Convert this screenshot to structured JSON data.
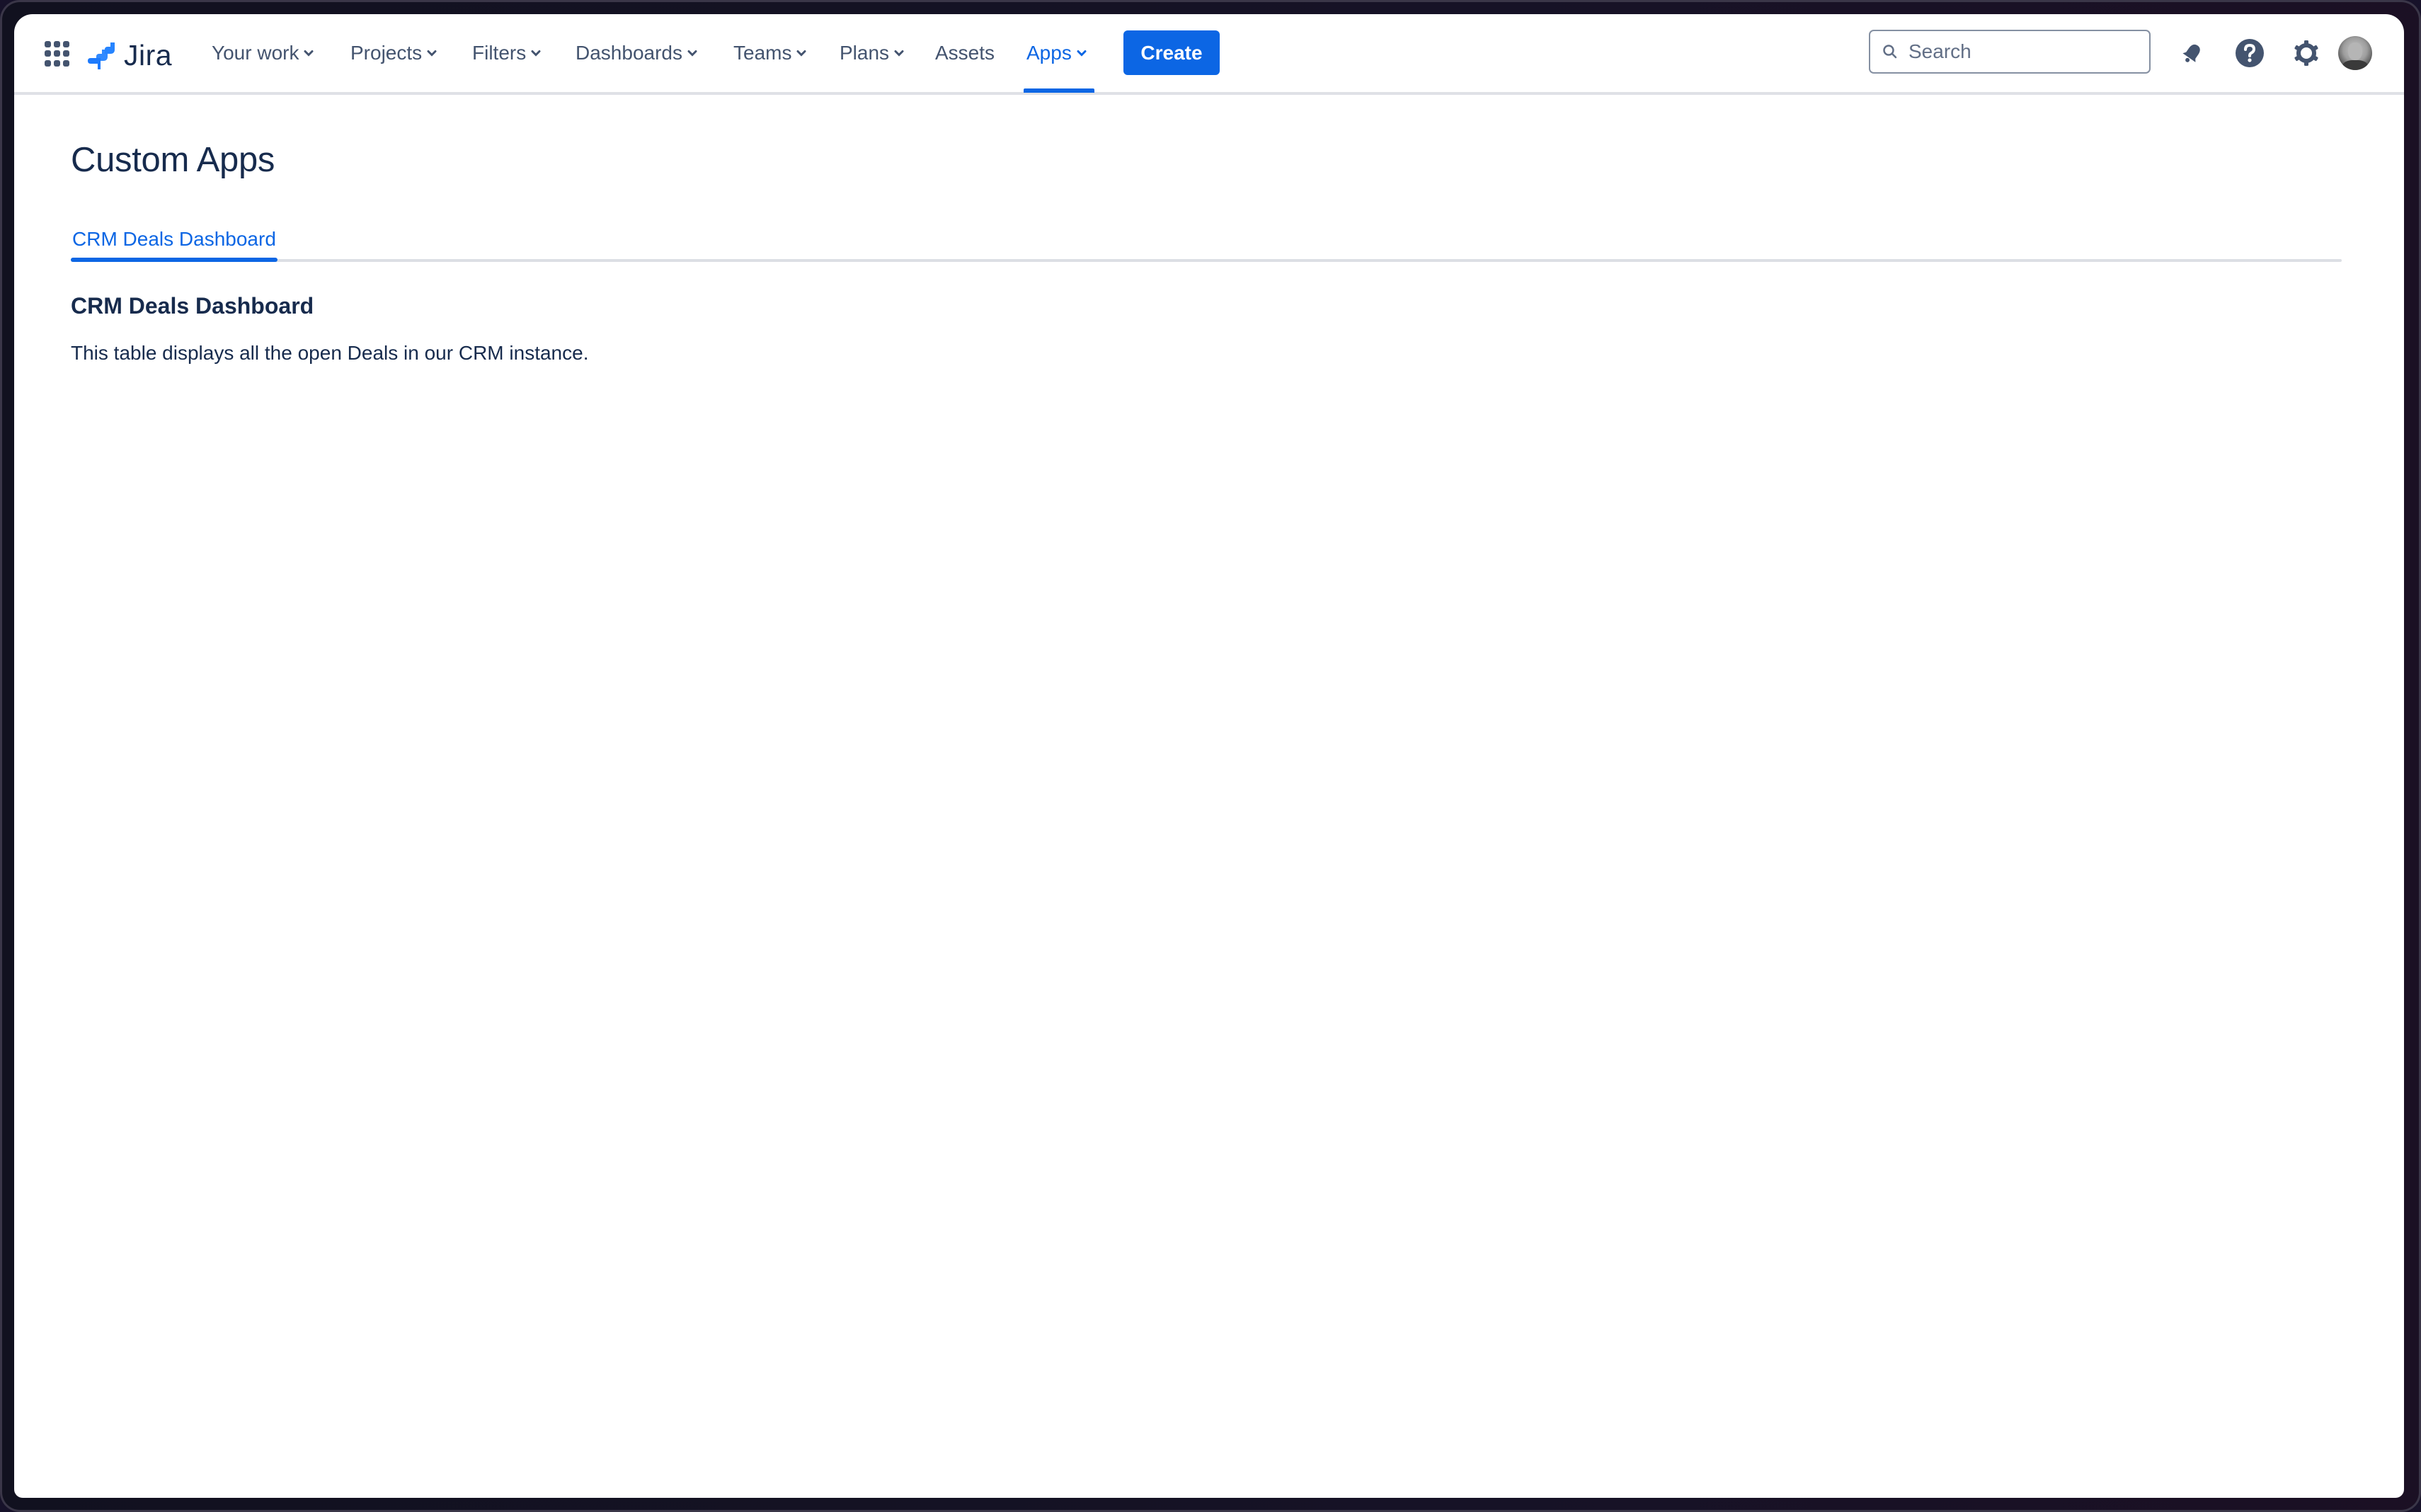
{
  "header": {
    "app_switcher_icon": "grid-dots-icon",
    "logo": {
      "icon": "jira-logo-icon",
      "wordmark": "Jira",
      "brand_color": "#2684ff"
    },
    "nav": [
      {
        "label": "Your work",
        "has_dropdown": true,
        "active": false
      },
      {
        "label": "Projects",
        "has_dropdown": true,
        "active": false
      },
      {
        "label": "Filters",
        "has_dropdown": true,
        "active": false
      },
      {
        "label": "Dashboards",
        "has_dropdown": true,
        "active": false
      },
      {
        "label": "Teams",
        "has_dropdown": true,
        "active": false
      },
      {
        "label": "Plans",
        "has_dropdown": true,
        "active": false
      },
      {
        "label": "Assets",
        "has_dropdown": false,
        "active": false
      },
      {
        "label": "Apps",
        "has_dropdown": true,
        "active": true
      }
    ],
    "create_label": "Create",
    "search": {
      "placeholder": "Search",
      "value": "",
      "icon": "search-icon"
    },
    "icons": {
      "notifications": "bell-icon",
      "help": "help-icon",
      "settings": "gear-icon",
      "profile": "avatar"
    },
    "colors": {
      "accent": "#0c66e4",
      "nav_text": "#44546f",
      "heading_text": "#172b4d"
    }
  },
  "page": {
    "title": "Custom Apps",
    "tabs": [
      {
        "label": "CRM Deals Dashboard",
        "selected": true
      }
    ],
    "section": {
      "title": "CRM Deals Dashboard",
      "description": "This table displays all the open Deals in our CRM instance."
    }
  }
}
